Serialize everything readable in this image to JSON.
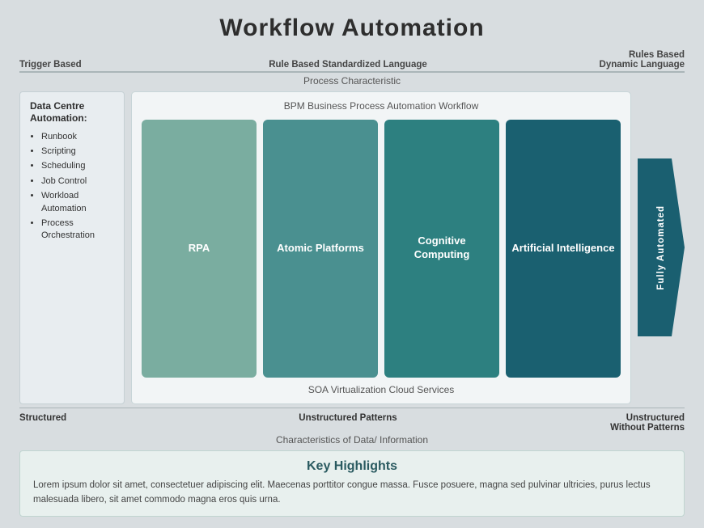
{
  "title": "Workflow Automation",
  "top_labels": {
    "left": "Trigger Based",
    "center": "Rule Based Standardized Language",
    "right": "Rules Based Dynamic Language"
  },
  "process_characteristic": "Process Characteristic",
  "left_panel": {
    "title": "Data Centre Automation:",
    "items": [
      "Runbook",
      "Scripting",
      "Scheduling",
      "Job Control",
      "Workload Automation",
      "Process Orchestration"
    ]
  },
  "bpm_label": "BPM Business Process Automation Workflow",
  "boxes": [
    {
      "label": "RPA",
      "class": "box-rpa"
    },
    {
      "label": "Atomic Platforms",
      "class": "box-atomic"
    },
    {
      "label": "Cognitive Computing",
      "class": "box-cognitive"
    },
    {
      "label": "Artificial Intelligence",
      "class": "box-ai"
    }
  ],
  "soa_label": "SOA Virtualization Cloud Services",
  "arrow_label": "Fully Automated",
  "bottom_labels": {
    "left": "Structured",
    "center": "Unstructured Patterns",
    "right": "Unstructured Without Patterns"
  },
  "char_of_data": "Characteristics of Data/ Information",
  "key_highlights": {
    "title": "Key Highlights",
    "text": "Lorem ipsum dolor sit amet, consectetuer adipiscing elit. Maecenas porttitor congue massa. Fusce posuere, magna sed pulvinar ultricies, purus lectus malesuada libero, sit amet commodo magna eros quis urna."
  }
}
